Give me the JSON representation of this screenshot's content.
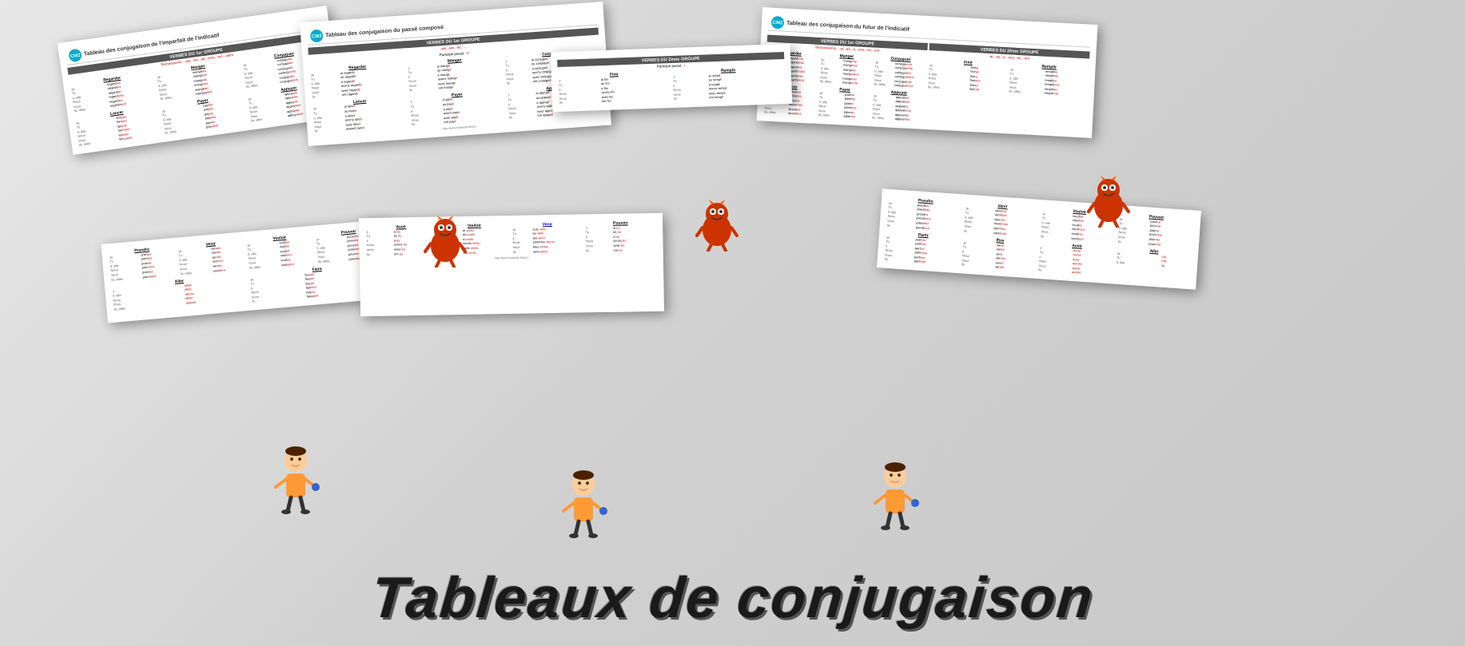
{
  "title": "Tableaux de conjugaison",
  "cards": [
    {
      "id": "imparfait",
      "badge": "CM2",
      "title": "Tableau des conjugaison de l'imparfait de l'indicatif",
      "groupTitle": "VERBES DU 1er GROUPE",
      "terminations": "Terminaisons : -ais, -ais, -ait, -ions, -iez, -aient"
    },
    {
      "id": "passe-compose",
      "badge": "CM2",
      "title": "Tableau des conjugaison du passé composé"
    },
    {
      "id": "futur",
      "badge": "CM2",
      "title": "Tableau des conjugaison du futur de l'indicatif"
    }
  ],
  "pronouns": [
    "Je",
    "Tu",
    "Il, elle",
    "Nous",
    "Vous",
    "Ils, elles"
  ],
  "bottom_title": "Tableaux de conjugaison"
}
